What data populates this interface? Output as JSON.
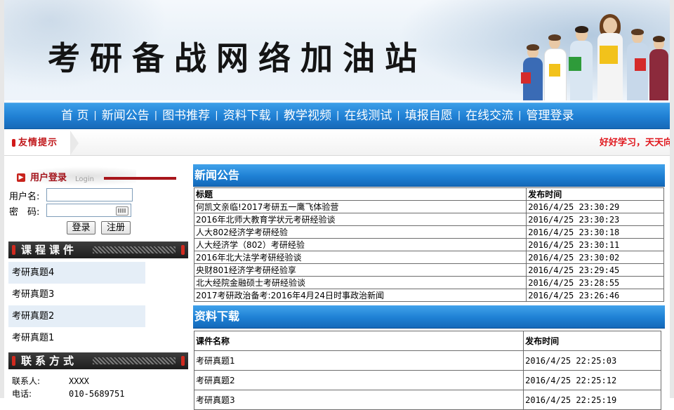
{
  "banner": {
    "title": "考研备战网络加油站"
  },
  "nav": {
    "items": [
      "首 页",
      "新闻公告",
      "图书推荐",
      "资料下载",
      "教学视频",
      "在线测试",
      "填报自愿",
      "在线交流",
      "管理登录"
    ],
    "separator": "|"
  },
  "notice": {
    "label": "友情提示",
    "marquee": "好好学习，天天向"
  },
  "login": {
    "title": "用户登录",
    "subtitle": "Login",
    "username_label": "用户名:",
    "password_label": "密　码:",
    "login_button": "登录",
    "register_button": "注册"
  },
  "courses": {
    "title": "课程课件",
    "items": [
      "考研真题4",
      "考研真题3",
      "考研真题2",
      "考研真题1"
    ]
  },
  "contact": {
    "title": "联系方式",
    "rows": [
      {
        "label": "联系人:",
        "value": "XXXX"
      },
      {
        "label": "电话:",
        "value": "010-5689751"
      }
    ]
  },
  "news": {
    "title": "新闻公告",
    "headers": [
      "标题",
      "发布时间"
    ],
    "rows": [
      {
        "title": "何凯文亲临!2017考研五一鹰飞体验营",
        "time": "2016/4/25 23:30:29"
      },
      {
        "title": "2016年北师大教育学状元考研经验谈",
        "time": "2016/4/25 23:30:23"
      },
      {
        "title": "人大802经济学考研经验",
        "time": "2016/4/25 23:30:18"
      },
      {
        "title": "人大经济学（802）考研经验",
        "time": "2016/4/25 23:30:11"
      },
      {
        "title": "2016年北大法学考研经验谈",
        "time": "2016/4/25 23:30:02"
      },
      {
        "title": "央财801经济学考研经验享",
        "time": "2016/4/25 23:29:45"
      },
      {
        "title": "北大经院金融硕士考研经验谈",
        "time": "2016/4/25 23:28:55"
      },
      {
        "title": "2017考研政治备考:2016年4月24日时事政治新闻",
        "time": "2016/4/25 23:26:46"
      }
    ]
  },
  "downloads": {
    "title": "资料下载",
    "headers": [
      "课件名称",
      "发布时间"
    ],
    "rows": [
      {
        "name": "考研真题1",
        "time": "2016/4/25 22:25:03"
      },
      {
        "name": "考研真题2",
        "time": "2016/4/25 22:25:12"
      },
      {
        "name": "考研真题3",
        "time": "2016/4/25 22:25:19"
      }
    ]
  },
  "colors": {
    "nav_blue": "#1f7fd3",
    "accent_red": "#c0171a",
    "dark_header": "#1d1d1d"
  }
}
